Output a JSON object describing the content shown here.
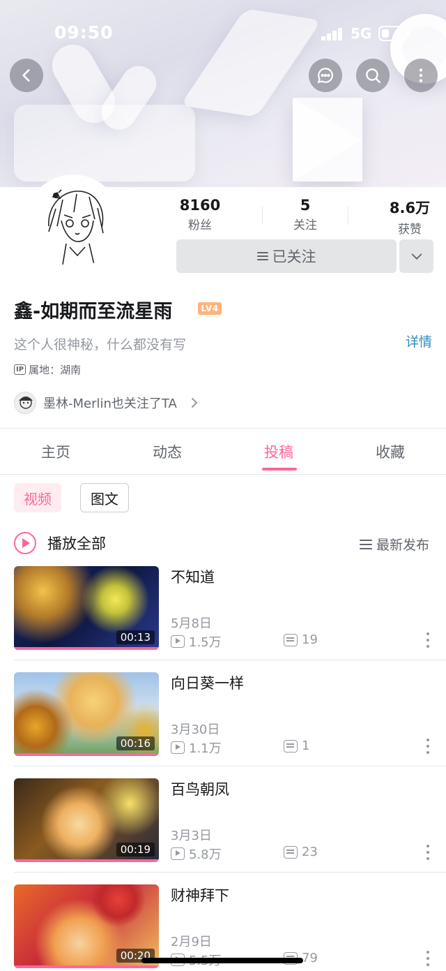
{
  "status_bar": {
    "time": "09:50",
    "network": "5G"
  },
  "profile": {
    "stats": [
      {
        "value": "8160",
        "label": "粉丝"
      },
      {
        "value": "5",
        "label": "关注"
      },
      {
        "value": "8.6万",
        "label": "获赞"
      }
    ],
    "follow_label": "已关注",
    "name": "鑫-如期而至流星雨",
    "level": "LV4",
    "signature": "这个人很神秘，什么都没有写",
    "detail_label": "详情",
    "ip_badge": "IP",
    "ip_location": "属地：湖南",
    "co_follow": "墨林-Merlin也关注了TA"
  },
  "tabs": [
    {
      "label": "主页"
    },
    {
      "label": "动态"
    },
    {
      "label": "投稿",
      "active": true
    },
    {
      "label": "收藏"
    }
  ],
  "filters": {
    "video": "视频",
    "article": "图文"
  },
  "play_all": "播放全部",
  "sort_label": "最新发布",
  "videos": [
    {
      "title": "不知道",
      "date": "5月8日",
      "plays": "1.5万",
      "danmaku": "19",
      "duration": "00:13"
    },
    {
      "title": "向日葵一样",
      "date": "3月30日",
      "plays": "1.1万",
      "danmaku": "1",
      "duration": "00:16"
    },
    {
      "title": "百鸟朝凤",
      "date": "3月3日",
      "plays": "5.8万",
      "danmaku": "23",
      "duration": "00:19"
    },
    {
      "title": "财神拜下",
      "date": "2月9日",
      "plays": "5.5万",
      "danmaku": "79",
      "duration": "00:20"
    }
  ],
  "colors": {
    "accent": "#ff6699",
    "link": "#2e8fbf",
    "level_badge": "#ffb27a"
  },
  "icons": [
    "back-icon",
    "message-icon",
    "search-icon",
    "more-vertical-icon",
    "play-circle-icon",
    "sort-icon",
    "play-count-icon",
    "danmaku-icon",
    "chevron-right-icon",
    "chevron-down-icon"
  ]
}
